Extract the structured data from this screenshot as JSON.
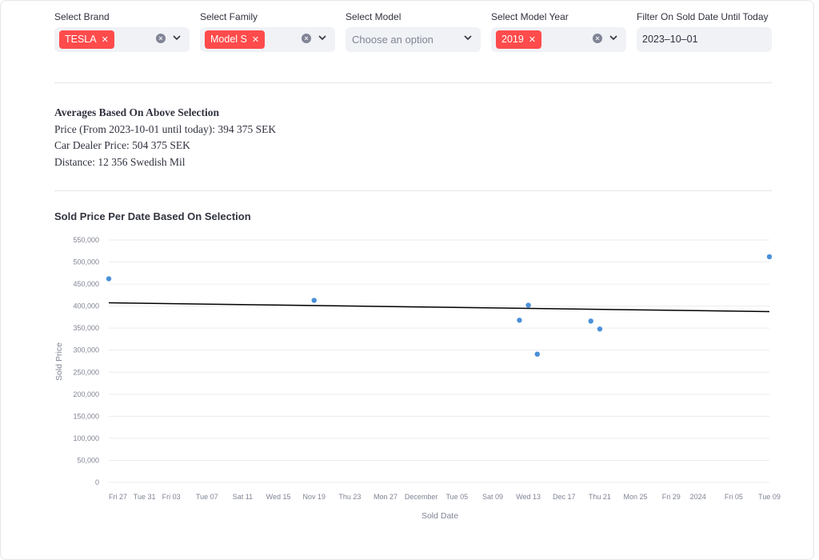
{
  "filters": {
    "brand": {
      "label": "Select Brand",
      "tags": [
        "TESLA"
      ]
    },
    "family": {
      "label": "Select Family",
      "tags": [
        "Model S"
      ]
    },
    "model": {
      "label": "Select Model",
      "placeholder": "Choose an option"
    },
    "year": {
      "label": "Select Model Year",
      "tags": [
        "2019"
      ]
    },
    "date": {
      "label": "Filter On Sold Date Until Today",
      "value": "2023–10–01"
    }
  },
  "averages": {
    "title": "Averages Based On Above Selection",
    "price": "Price (From 2023-10-01 until today): 394 375 SEK",
    "dealer_price": "Car Dealer Price: 504 375 SEK",
    "distance": "Distance: 12 356 Swedish Mil"
  },
  "chart_title": "Sold Price Per Date Based On Selection",
  "colors": {
    "accent": "#ff4b4b",
    "point": "#4a90d9",
    "trend": "#000000",
    "grid": "#ececec"
  },
  "chart_data": {
    "type": "scatter",
    "title": "Sold Price Per Date Based On Selection",
    "xlabel": "Sold Date",
    "ylabel": "Sold Price",
    "ylim": [
      0,
      550000
    ],
    "yticks": [
      "0",
      "50,000",
      "100,000",
      "150,000",
      "200,000",
      "250,000",
      "300,000",
      "350,000",
      "400,000",
      "450,000",
      "500,000",
      "550,000"
    ],
    "xticks": [
      {
        "label": "Fri 27",
        "date": "2023-10-27"
      },
      {
        "label": "Tue 31",
        "date": "2023-10-31"
      },
      {
        "label": "Fri 03",
        "date": "2023-11-03"
      },
      {
        "label": "Tue 07",
        "date": "2023-11-07"
      },
      {
        "label": "Sat 11",
        "date": "2023-11-11"
      },
      {
        "label": "Wed 15",
        "date": "2023-11-15"
      },
      {
        "label": "Nov 19",
        "date": "2023-11-19"
      },
      {
        "label": "Thu 23",
        "date": "2023-11-23"
      },
      {
        "label": "Mon 27",
        "date": "2023-11-27"
      },
      {
        "label": "December",
        "date": "2023-12-01"
      },
      {
        "label": "Tue 05",
        "date": "2023-12-05"
      },
      {
        "label": "Sat 09",
        "date": "2023-12-09"
      },
      {
        "label": "Wed 13",
        "date": "2023-12-13"
      },
      {
        "label": "Dec 17",
        "date": "2023-12-17"
      },
      {
        "label": "Thu 21",
        "date": "2023-12-21"
      },
      {
        "label": "Mon 25",
        "date": "2023-12-25"
      },
      {
        "label": "Fri 29",
        "date": "2023-12-29"
      },
      {
        "label": "2024",
        "date": "2024-01-01"
      },
      {
        "label": "Fri 05",
        "date": "2024-01-05"
      },
      {
        "label": "Tue 09",
        "date": "2024-01-09"
      }
    ],
    "xlim": [
      "2023-10-27",
      "2024-01-09"
    ],
    "points": [
      {
        "x": "2023-10-27",
        "y": 462000
      },
      {
        "x": "2023-11-19",
        "y": 413000
      },
      {
        "x": "2023-12-12",
        "y": 368000
      },
      {
        "x": "2023-12-13",
        "y": 402000
      },
      {
        "x": "2023-12-14",
        "y": 291000
      },
      {
        "x": "2023-12-20",
        "y": 366000
      },
      {
        "x": "2023-12-21",
        "y": 348000
      },
      {
        "x": "2024-01-09",
        "y": 512000
      }
    ],
    "trendline": [
      {
        "x": "2023-10-27",
        "y": 407500
      },
      {
        "x": "2024-01-09",
        "y": 387500
      }
    ],
    "grid": true
  }
}
